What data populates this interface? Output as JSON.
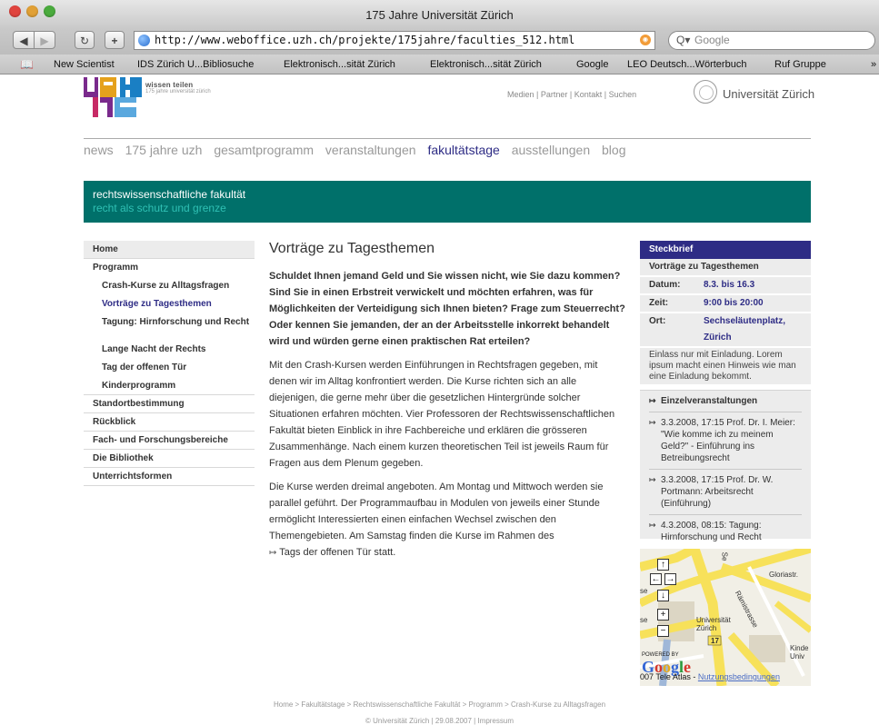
{
  "browser": {
    "window_title": "175 Jahre Universität Zürich",
    "url": "http://www.weboffice.uzh.ch/projekte/175jahre/faculties_512.html",
    "search_placeholder": "Google",
    "bookmarks": [
      "New Scientist",
      "IDS Zürich U...Bibliosuche",
      "Elektronisch...sität Zürich",
      "Elektronisch...sität Zürich",
      "Google",
      "LEO Deutsch...Wörterbuch",
      "Ruf Gruppe"
    ]
  },
  "header": {
    "logo_letters": "UZH 175",
    "tagline": "wissen teilen",
    "tagline_sub": "175 jahre universität zürich",
    "toplinks": "Medien  |  Partner  |  Kontakt  |  Suchen",
    "university": "Universität Zürich"
  },
  "mainnav": [
    "news",
    "175 jahre uzh",
    "gesamtprogramm",
    "veranstaltungen",
    "fakultätstage",
    "ausstellungen",
    "blog"
  ],
  "banner": {
    "title": "rechtswissenschaftliche fakultät",
    "subtitle": "recht als schutz und grenze"
  },
  "leftnav": {
    "home": "Home",
    "programm": "Programm",
    "sub": [
      "Crash-Kurse zu Alltagsfragen",
      "Vorträge zu Tagesthemen",
      "Tagung: Hirnforschung und Recht",
      "Lange Nacht der Rechts",
      "Tag der offenen Tür",
      "Kinderprogramm"
    ],
    "rest": [
      "Standortbestimmung",
      "Rückblick",
      "Fach- und Forschungsbereiche",
      "Die Bibliothek",
      "Unterrichtsformen"
    ]
  },
  "content": {
    "title": "Vorträge zu Tagesthemen",
    "lead": "Schuldet Ihnen jemand Geld und Sie wissen nicht, wie Sie dazu kommen? Sind Sie in einen Erbstreit verwickelt und möchten erfahren, was für Möglichkeiten der Verteidigung sich Ihnen bieten? Frage zum Steuerrecht? Oder kennen Sie jemanden, der an der Arbeitsstelle inkorrekt behandelt wird und würden gerne einen praktischen Rat erteilen?",
    "para1": "Mit den Crash-Kursen werden Einführungen in Rechtsfragen gegeben, mit denen wir im Alltag konfrontiert werden. Die Kurse richten sich an alle diejenigen, die gerne mehr über die gesetzlichen Hintergründe solcher Situationen erfahren möchten. Vier Professoren der Rechtswissenschaftlichen Fakultät bieten Einblick in ihre Fachbereiche und erklären die grösseren Zusammenhänge. Nach einem kurzen theoretischen Teil ist jeweils Raum für Fragen aus dem Plenum gegeben.",
    "para2": "Die Kurse werden dreimal angeboten. Am Montag und Mittwoch werden sie parallel geführt. Der Programmaufbau in Modulen von jeweils einer Stunde ermöglicht Interessierten einen einfachen Wechsel zwischen den Themengebieten. Am Samstag finden die Kurse im Rahmen des",
    "link": "Tags der offenen Tür",
    "para2_end": " statt."
  },
  "steckbrief": {
    "head": "Steckbrief",
    "subtitle": "Vorträge zu Tagesthemen",
    "rows": [
      {
        "k": "Datum:",
        "v": "8.3. bis 16.3"
      },
      {
        "k": "Zeit:",
        "v": "9:00 bis 20:00"
      },
      {
        "k": "Ort:",
        "v": "Sechseläutenplatz, Zürich"
      }
    ],
    "note": "Einlass nur mit Einladung. Lorem ipsum macht einen Hinweis wie man eine Einladung bekommt."
  },
  "events": {
    "head": "Einzelveranstaltungen",
    "items": [
      "3.3.2008, 17:15 Prof. Dr. I. Meier: \"Wie komme ich zu meinem Geld?\" - Einführung ins Betreibungsrecht",
      "3.3.2008, 17:15 Prof. Dr. W. Portmann: Arbeitsrecht (Einführung)",
      "4.3.2008, 08:15: Tagung: Hirnforschung und Recht"
    ]
  },
  "map": {
    "labels": [
      "Gloriastr.",
      "Rämistrasse",
      "Universität Zürich",
      "17",
      "Kinde Univ",
      "se",
      "se",
      "Se"
    ],
    "powered": "POWERED BY",
    "google": "Google",
    "copyright": "007 Tele Atlas - ",
    "terms": "Nutzungsbedingungen"
  },
  "footer": {
    "breadcrumb": "Home > Fakultätstage > Rechtswissenschaftliche Fakultät > Programm > Crash-Kurse zu Alltagsfragen",
    "copyright": "© Universität Zürich  |  29.08.2007  |  Impressum"
  }
}
